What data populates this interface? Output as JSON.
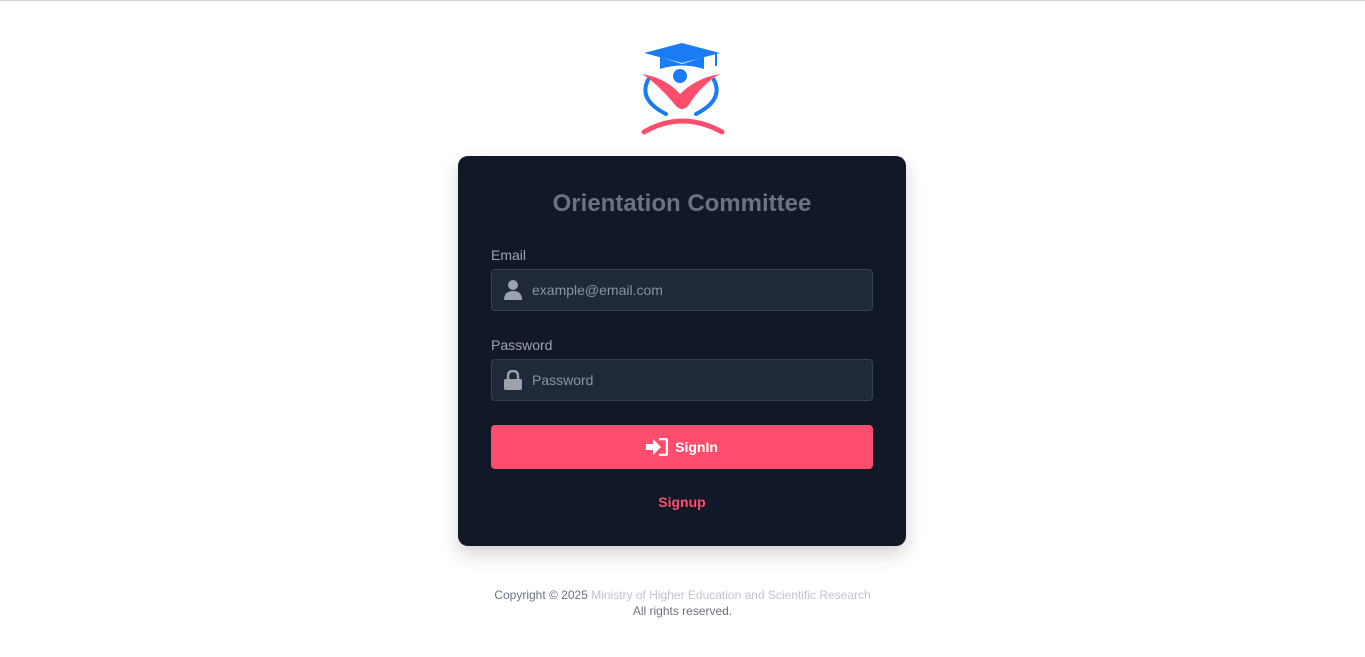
{
  "card": {
    "title": "Orientation Committee"
  },
  "email": {
    "label": "Email",
    "placeholder": "example@email.com",
    "icon": "user-icon"
  },
  "password": {
    "label": "Password",
    "placeholder": "Password",
    "icon": "lock-icon"
  },
  "signin": {
    "label": "SignIn",
    "icon": "sign-in-icon"
  },
  "signup": {
    "label": "Signup"
  },
  "footer": {
    "copyright": "Copyright © 2025",
    "organization": "Ministry of Higher Education and Scientific Research",
    "rights": "All rights reserved."
  },
  "colors": {
    "accent": "#ff4d6d",
    "brand_blue": "#1a7cf5",
    "card_background": "#111827"
  }
}
